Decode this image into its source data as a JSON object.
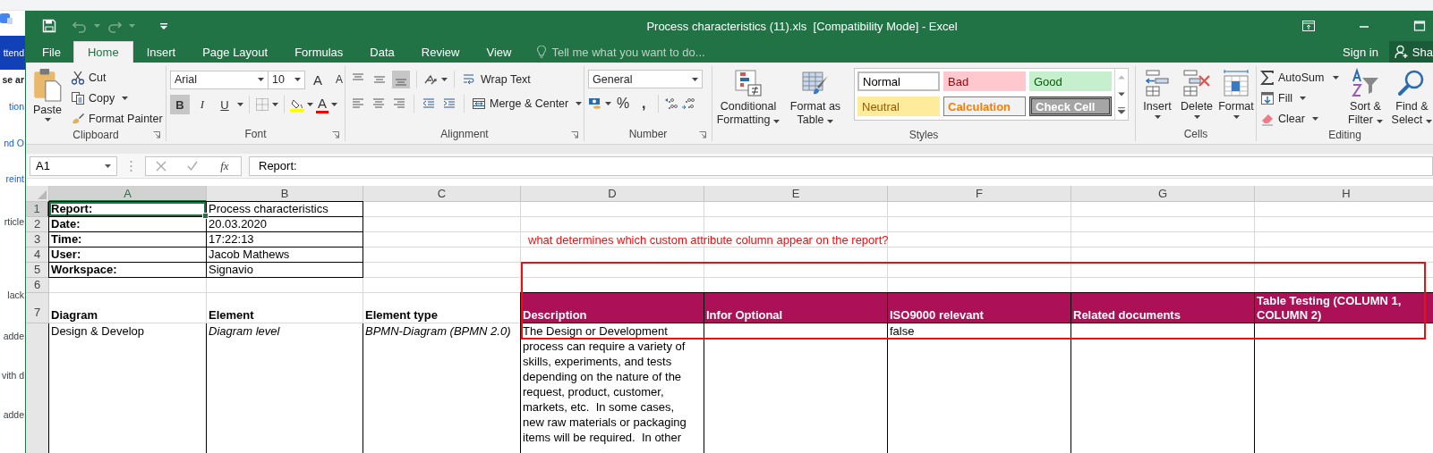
{
  "background_page": {
    "fragments": [
      {
        "text": "ttend",
        "kind": "banner"
      },
      {
        "text": "se ar",
        "kind": "heading"
      },
      {
        "text": "tion",
        "kind": "link"
      },
      {
        "text": "nd O",
        "kind": "link"
      },
      {
        "text": "reint",
        "kind": "link"
      },
      {
        "text": "rticle",
        "kind": "plain"
      },
      {
        "text": "lack",
        "kind": "plain"
      },
      {
        "text": "adde",
        "kind": "plain"
      },
      {
        "text": "vith d",
        "kind": "plain"
      },
      {
        "text": "adde",
        "kind": "plain"
      }
    ]
  },
  "window": {
    "title": "Process characteristics (11).xls  [Compatibility Mode] - Excel"
  },
  "tabs": [
    {
      "label": "File",
      "selected": false
    },
    {
      "label": "Home",
      "selected": true
    },
    {
      "label": "Insert",
      "selected": false
    },
    {
      "label": "Page Layout",
      "selected": false
    },
    {
      "label": "Formulas",
      "selected": false
    },
    {
      "label": "Data",
      "selected": false
    },
    {
      "label": "Review",
      "selected": false
    },
    {
      "label": "View",
      "selected": false
    }
  ],
  "tell_me": {
    "placeholder": "Tell me what you want to do..."
  },
  "account": {
    "sign_in": "Sign in",
    "share": "Sha"
  },
  "clipboard": {
    "label": "Clipboard",
    "paste": "Paste",
    "cut": "Cut",
    "copy": "Copy",
    "format_painter": "Format Painter"
  },
  "font": {
    "label": "Font",
    "name": "Arial",
    "size": "10",
    "grow": "A",
    "shrink": "A",
    "color_letter": "A",
    "toggles": [
      {
        "label": "B",
        "kind": "bold",
        "on": true
      },
      {
        "label": "I",
        "kind": "italic",
        "on": false
      },
      {
        "label": "U",
        "kind": "underline",
        "on": false
      }
    ]
  },
  "alignment": {
    "label": "Alignment",
    "vertical": [
      {
        "kind": "top",
        "on": false
      },
      {
        "kind": "middle",
        "on": false
      },
      {
        "kind": "bottom",
        "on": true
      }
    ],
    "wrap_text": "Wrap Text",
    "merge_center": "Merge & Center"
  },
  "number": {
    "label": "Number",
    "format": "General",
    "percent": "%",
    "comma": ","
  },
  "styles": {
    "label": "Styles",
    "conditional": "Conditional Formatting",
    "table": "Format as Table",
    "gallery": [
      {
        "label": "Normal",
        "kind": "normal"
      },
      {
        "label": "Bad",
        "kind": "bad"
      },
      {
        "label": "Good",
        "kind": "good"
      },
      {
        "label": "Neutral",
        "kind": "neutral"
      },
      {
        "label": "Calculation",
        "kind": "calculation"
      },
      {
        "label": "Check Cell",
        "kind": "check"
      }
    ]
  },
  "cells": {
    "label": "Cells",
    "insert": "Insert",
    "delete": "Delete",
    "format": "Format"
  },
  "editing": {
    "label": "Editing",
    "autosum": "AutoSum",
    "fill": "Fill",
    "clear": "Clear",
    "sort_filter": "Sort & Filter",
    "find_select": "Find & Select"
  },
  "formula_bar": {
    "name_box": "A1",
    "function_label": "fx",
    "value": "Report:"
  },
  "sheet": {
    "columns": [
      {
        "label": "A",
        "selected": true
      },
      {
        "label": "B",
        "selected": false
      },
      {
        "label": "C",
        "selected": false
      },
      {
        "label": "D",
        "selected": false
      },
      {
        "label": "E",
        "selected": false
      },
      {
        "label": "F",
        "selected": false
      },
      {
        "label": "G",
        "selected": false
      },
      {
        "label": "H",
        "selected": false
      }
    ],
    "rows": [
      {
        "number": "1",
        "selected": true,
        "cells": [
          {
            "text": "Report:",
            "kind": "label"
          },
          {
            "text": "Process characteristics",
            "kind": "boxed"
          },
          {
            "kind": "blank"
          },
          {
            "kind": "blank"
          },
          {
            "kind": "blank"
          },
          {
            "kind": "blank"
          },
          {
            "kind": "blank"
          },
          {
            "kind": "blank"
          }
        ]
      },
      {
        "number": "2",
        "selected": false,
        "cells": [
          {
            "text": "Date:",
            "kind": "label"
          },
          {
            "text": "20.03.2020",
            "kind": "boxed"
          },
          {
            "kind": "blank"
          },
          {
            "kind": "blank"
          },
          {
            "kind": "blank"
          },
          {
            "kind": "blank"
          },
          {
            "kind": "blank"
          },
          {
            "kind": "blank"
          }
        ]
      },
      {
        "number": "3",
        "selected": false,
        "cells": [
          {
            "text": "Time:",
            "kind": "label"
          },
          {
            "text": "17:22:13",
            "kind": "boxed"
          },
          {
            "kind": "blank"
          },
          {
            "text": "what determines which custom attribute column appear on the report?",
            "kind": "note"
          },
          {
            "kind": "blank"
          },
          {
            "kind": "blank"
          },
          {
            "kind": "blank"
          },
          {
            "kind": "blank"
          }
        ]
      },
      {
        "number": "4",
        "selected": false,
        "cells": [
          {
            "text": "User:",
            "kind": "label"
          },
          {
            "text": "Jacob Mathews",
            "kind": "boxed"
          },
          {
            "kind": "blank"
          },
          {
            "kind": "blank"
          },
          {
            "kind": "blank"
          },
          {
            "kind": "blank"
          },
          {
            "kind": "blank"
          },
          {
            "kind": "blank"
          }
        ]
      },
      {
        "number": "5",
        "selected": false,
        "cells": [
          {
            "text": "Workspace:",
            "kind": "label"
          },
          {
            "text": "Signavio",
            "kind": "boxed"
          },
          {
            "kind": "blank"
          },
          {
            "kind": "blank"
          },
          {
            "kind": "blank"
          },
          {
            "kind": "blank"
          },
          {
            "kind": "blank"
          },
          {
            "kind": "blank"
          }
        ]
      },
      {
        "number": "6",
        "selected": false,
        "cells": [
          {
            "kind": "blank"
          },
          {
            "kind": "blank"
          },
          {
            "kind": "blank"
          },
          {
            "kind": "blank"
          },
          {
            "kind": "blank"
          },
          {
            "kind": "blank"
          },
          {
            "kind": "blank"
          },
          {
            "kind": "blank"
          }
        ]
      },
      {
        "number": "7",
        "selected": false,
        "cells": [
          {
            "text": "Diagram",
            "kind": "title"
          },
          {
            "text": "Element",
            "kind": "title"
          },
          {
            "text": "Element type",
            "kind": "title"
          },
          {
            "text": "Description",
            "kind": "header"
          },
          {
            "text": "Infor Optional",
            "kind": "header"
          },
          {
            "text": "ISO9000 relevant",
            "kind": "header"
          },
          {
            "text": "Related documents",
            "kind": "header"
          },
          {
            "text": "Table Testing (COLUMN 1, COLUMN 2)",
            "kind": "header"
          }
        ]
      },
      {
        "selected": false,
        "cells": [
          {
            "text": "Design & Develop",
            "kind": "entry"
          },
          {
            "text": "Diagram level",
            "kind": "entry_italic"
          },
          {
            "text": "BPMN-Diagram (BPMN 2.0)",
            "kind": "entry_italic"
          },
          {
            "text": "The Design or Development\nprocess can require a variety of\nskills, experiments, and tests\ndepending on the nature of the\nrequest, product, customer,\nmarkets, etc.  In some cases,\nnew raw materials or packaging\nitems will be required.  In other",
            "kind": "entry"
          },
          {
            "kind": "entry"
          },
          {
            "text": "false",
            "kind": "entry"
          },
          {
            "kind": "entry"
          },
          {
            "kind": "entry"
          }
        ]
      }
    ]
  }
}
